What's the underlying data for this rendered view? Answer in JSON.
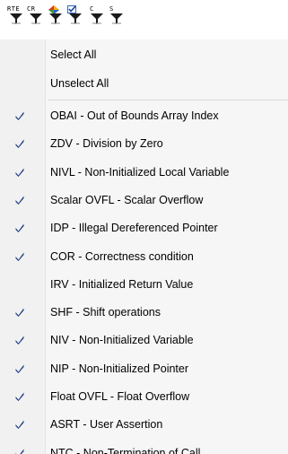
{
  "toolbar": {
    "buttons": [
      {
        "label": "RTE",
        "icon": "rte-filter-icon"
      },
      {
        "label": "CR",
        "icon": "cr-filter-icon"
      },
      {
        "label": "",
        "icon": "color-filter-icon"
      },
      {
        "label": "",
        "icon": "checked-filter-icon"
      },
      {
        "label": "C",
        "icon": "c-filter-icon"
      },
      {
        "label": "S",
        "icon": "s-filter-icon"
      }
    ]
  },
  "menu": {
    "select_all": "Select All",
    "unselect_all": "Unselect All",
    "items": [
      {
        "label": "OBAI - Out of Bounds Array Index",
        "checked": true
      },
      {
        "label": "ZDV - Division by Zero",
        "checked": true
      },
      {
        "label": "NIVL - Non-Initialized Local Variable",
        "checked": true
      },
      {
        "label": "Scalar OVFL - Scalar Overflow",
        "checked": true
      },
      {
        "label": "IDP - Illegal Dereferenced Pointer",
        "checked": true
      },
      {
        "label": "COR - Correctness condition",
        "checked": true
      },
      {
        "label": "IRV - Initialized Return Value",
        "checked": false
      },
      {
        "label": "SHF - Shift operations",
        "checked": true
      },
      {
        "label": "NIV - Non-Initialized Variable",
        "checked": true
      },
      {
        "label": "NIP - Non-Initialized Pointer",
        "checked": true
      },
      {
        "label": "Float OVFL - Float Overflow",
        "checked": true
      },
      {
        "label": "ASRT - User Assertion",
        "checked": true
      },
      {
        "label": "NTC - Non-Termination of Call",
        "checked": true
      }
    ]
  }
}
